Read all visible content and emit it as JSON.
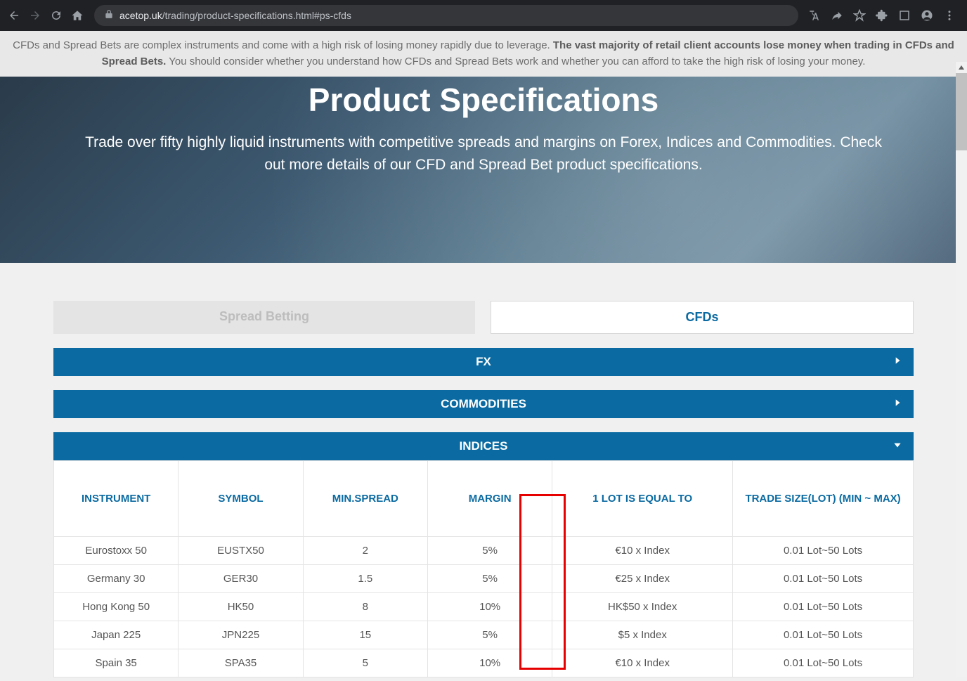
{
  "browser": {
    "url_domain": "acetop.uk",
    "url_path": "/trading/product-specifications.html#ps-cfds"
  },
  "warning": {
    "part1": "CFDs and Spread Bets are complex instruments and come with a high risk of losing money rapidly due to leverage. ",
    "bold1": "The vast majority of retail client accounts lose money when trading in CFDs and Spread Bets.",
    "part2": " You should consider whether you understand how CFDs and Spread Bets work and whether you can afford to take the high risk of losing your money."
  },
  "hero": {
    "title": "Product Specifications",
    "subtitle": "Trade over fifty highly liquid instruments with competitive spreads and margins on Forex, Indices and Commodities. Check out more details of our CFD and Spread Bet product specifications."
  },
  "tabs": {
    "spread_betting": "Spread Betting",
    "cfds": "CFDs"
  },
  "accordions": {
    "fx": "FX",
    "commodities": "COMMODITIES",
    "indices": "INDICES"
  },
  "table": {
    "headers": {
      "instrument": "INSTRUMENT",
      "symbol": "SYMBOL",
      "min_spread": "MIN.SPREAD",
      "margin": "MARGIN",
      "lot_equal": "1 LOT IS EQUAL TO",
      "trade_size": "TRADE SIZE(LOT) (MIN ~ MAX)"
    },
    "rows": [
      {
        "instrument": "Eurostoxx 50",
        "symbol": "EUSTX50",
        "min_spread": "2",
        "margin": "5%",
        "lot_equal": "€10 x Index",
        "trade_size": "0.01 Lot~50 Lots"
      },
      {
        "instrument": "Germany 30",
        "symbol": "GER30",
        "min_spread": "1.5",
        "margin": "5%",
        "lot_equal": "€25 x Index",
        "trade_size": "0.01 Lot~50 Lots"
      },
      {
        "instrument": "Hong Kong 50",
        "symbol": "HK50",
        "min_spread": "8",
        "margin": "10%",
        "lot_equal": "HK$50 x Index",
        "trade_size": "0.01 Lot~50 Lots"
      },
      {
        "instrument": "Japan 225",
        "symbol": "JPN225",
        "min_spread": "15",
        "margin": "5%",
        "lot_equal": "$5 x Index",
        "trade_size": "0.01 Lot~50 Lots"
      },
      {
        "instrument": "Spain 35",
        "symbol": "SPA35",
        "min_spread": "5",
        "margin": "10%",
        "lot_equal": "€10 x Index",
        "trade_size": "0.01 Lot~50 Lots"
      }
    ]
  }
}
